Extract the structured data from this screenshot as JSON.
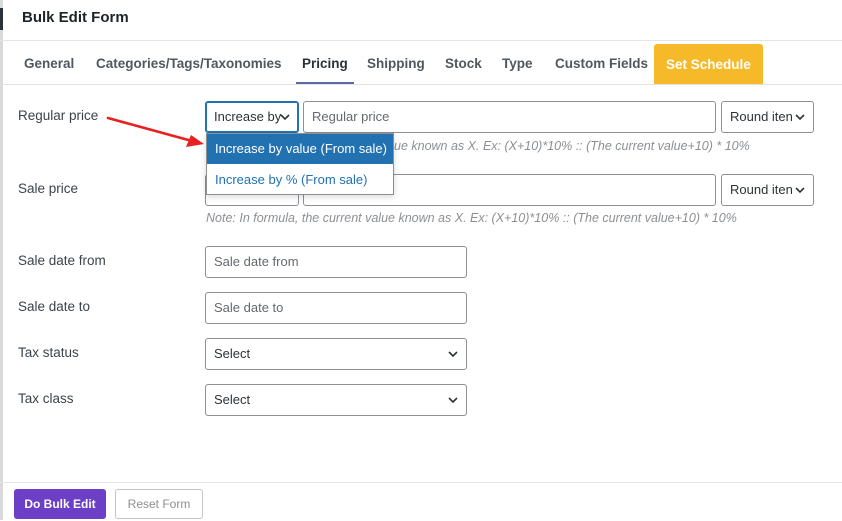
{
  "window": {
    "title": "Bulk Edit Form"
  },
  "tabs": [
    {
      "label": "General"
    },
    {
      "label": "Categories/Tags/Taxonomies"
    },
    {
      "label": "Pricing"
    },
    {
      "label": "Shipping"
    },
    {
      "label": "Stock"
    },
    {
      "label": "Type"
    },
    {
      "label": "Custom Fields"
    },
    {
      "label": "Set Schedule"
    }
  ],
  "active_tab": "Pricing",
  "regular_price": {
    "label": "Regular price",
    "operator_value": "Increase by",
    "value_placeholder": "Regular price",
    "round_value": "Round iten",
    "note": "ue known as X. Ex: (X+10)*10% :: (The current value+10) * 10%"
  },
  "operator_dropdown": {
    "options": [
      "Increase by value (From sale)",
      "Increase by % (From sale)"
    ],
    "selected_index": 0
  },
  "sale_price": {
    "label": "Sale price",
    "round_value": "Round iten",
    "note": "Note: In formula, the current value known as X. Ex: (X+10)*10% :: (The current value+10) * 10%"
  },
  "sale_date_from": {
    "label": "Sale date from",
    "placeholder": "Sale date from"
  },
  "sale_date_to": {
    "label": "Sale date to",
    "placeholder": "Sale date to"
  },
  "tax_status": {
    "label": "Tax status",
    "value": "Select"
  },
  "tax_class": {
    "label": "Tax class",
    "value": "Select"
  },
  "footer": {
    "primary": "Do Bulk Edit",
    "secondary": "Reset Form"
  },
  "colors": {
    "accent": "#2271b1",
    "primary_button": "#6b3fc6",
    "schedule_tab": "#f6b929",
    "annotation_arrow": "#e8201f"
  }
}
